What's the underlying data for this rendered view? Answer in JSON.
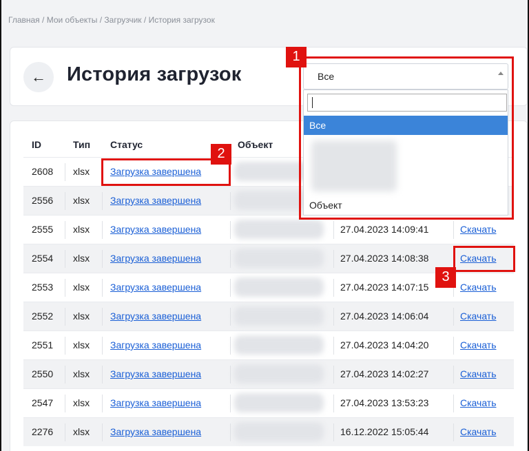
{
  "breadcrumb": {
    "home": "Главная",
    "objects": "Мои объекты",
    "loader": "Загрузчик",
    "current": "История загрузок"
  },
  "page": {
    "title": "История загрузок",
    "back_icon": "arrow-left-icon"
  },
  "filter": {
    "selected": "Все",
    "search_value": "",
    "options": [
      "Все",
      "Объект"
    ]
  },
  "table": {
    "headers": {
      "id": "ID",
      "type": "Тип",
      "status": "Статус",
      "object": "Объект"
    },
    "rows": [
      {
        "id": "2608",
        "type": "xlsx",
        "status": "Загрузка завершена",
        "date": "",
        "action": ""
      },
      {
        "id": "2556",
        "type": "xlsx",
        "status": "Загрузка завершена",
        "date": "",
        "action": ""
      },
      {
        "id": "2555",
        "type": "xlsx",
        "status": "Загрузка завершена",
        "date": "27.04.2023 14:09:41",
        "action": "Скачать"
      },
      {
        "id": "2554",
        "type": "xlsx",
        "status": "Загрузка завершена",
        "date": "27.04.2023 14:08:38",
        "action": "Скачать"
      },
      {
        "id": "2553",
        "type": "xlsx",
        "status": "Загрузка завершена",
        "date": "27.04.2023 14:07:15",
        "action": "Скачать"
      },
      {
        "id": "2552",
        "type": "xlsx",
        "status": "Загрузка завершена",
        "date": "27.04.2023 14:06:04",
        "action": "Скачать"
      },
      {
        "id": "2551",
        "type": "xlsx",
        "status": "Загрузка завершена",
        "date": "27.04.2023 14:04:20",
        "action": "Скачать"
      },
      {
        "id": "2550",
        "type": "xlsx",
        "status": "Загрузка завершена",
        "date": "27.04.2023 14:02:27",
        "action": "Скачать"
      },
      {
        "id": "2547",
        "type": "xlsx",
        "status": "Загрузка завершена",
        "date": "27.04.2023 13:53:23",
        "action": "Скачать"
      },
      {
        "id": "2276",
        "type": "xlsx",
        "status": "Загрузка завершена",
        "date": "16.12.2022 15:05:44",
        "action": "Скачать"
      }
    ]
  },
  "annotations": {
    "one": "1",
    "two": "2",
    "three": "3",
    "color": "#e0120f"
  }
}
